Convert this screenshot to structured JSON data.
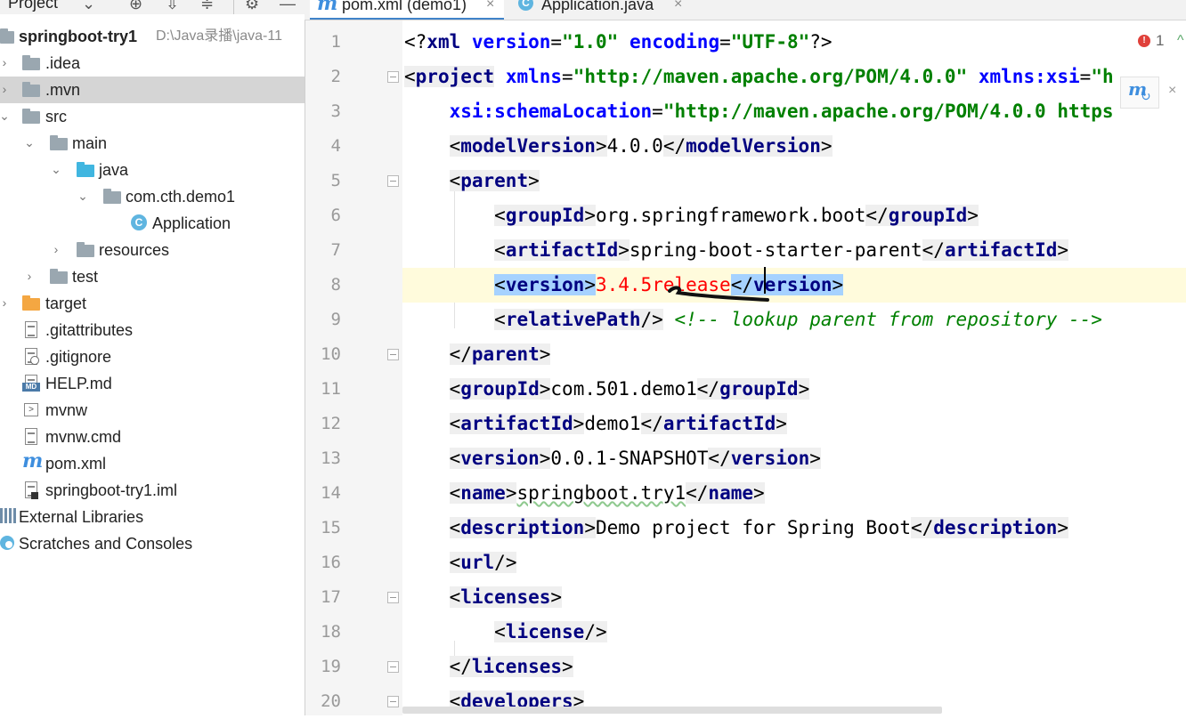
{
  "project_panel": {
    "title": "Project",
    "header_icons": [
      "chevron-down-icon",
      "locate-icon",
      "expand-all-icon",
      "collapse-all-icon",
      "gear-icon",
      "minimize-icon"
    ],
    "tree": [
      {
        "label": "springboot-try1",
        "path": "D:\\Java录播\\java-11",
        "icon": "module-folder-icon",
        "bold": true
      },
      {
        "label": ".idea",
        "icon": "folder-icon"
      },
      {
        "label": ".mvn",
        "icon": "folder-icon",
        "selected": true
      },
      {
        "label": "src",
        "icon": "folder-icon"
      },
      {
        "label": "main",
        "icon": "folder-icon"
      },
      {
        "label": "java",
        "icon": "source-folder-icon"
      },
      {
        "label": "com.cth.demo1",
        "icon": "package-icon"
      },
      {
        "label": "Application",
        "icon": "class-icon"
      },
      {
        "label": "resources",
        "icon": "resources-folder-icon"
      },
      {
        "label": "test",
        "icon": "folder-icon"
      },
      {
        "label": "target",
        "icon": "excluded-folder-icon"
      },
      {
        "label": ".gitattributes",
        "icon": "text-file-icon"
      },
      {
        "label": ".gitignore",
        "icon": "gitignore-file-icon"
      },
      {
        "label": "HELP.md",
        "icon": "markdown-file-icon",
        "badge": "MD"
      },
      {
        "label": "mvnw",
        "icon": "script-file-icon"
      },
      {
        "label": "mvnw.cmd",
        "icon": "text-file-icon"
      },
      {
        "label": "pom.xml",
        "icon": "maven-icon"
      },
      {
        "label": "springboot-try1.iml",
        "icon": "iml-file-icon"
      },
      {
        "label": "External Libraries",
        "icon": "libraries-icon"
      },
      {
        "label": "Scratches and Consoles",
        "icon": "scratches-icon"
      }
    ]
  },
  "tabs": [
    {
      "label": "pom.xml (demo1)",
      "icon": "maven-icon",
      "active": true
    },
    {
      "label": "Application.java",
      "icon": "class-icon",
      "active": false
    }
  ],
  "editor": {
    "error_count": "1",
    "line_numbers": [
      "1",
      "2",
      "3",
      "4",
      "5",
      "6",
      "7",
      "8",
      "9",
      "10",
      "11",
      "12",
      "13",
      "14",
      "15",
      "16",
      "17",
      "18",
      "19",
      "20"
    ],
    "code": {
      "l1_decl_open": "<?",
      "l1_xml": "xml",
      "l1_version_attr": "version",
      "l1_version_val": "\"1.0\"",
      "l1_encoding_attr": "encoding",
      "l1_encoding_val": "\"UTF-8\"",
      "l1_decl_close": "?>",
      "l2_tag": "project",
      "l2_attr": "xmlns",
      "l2_val": "\"http://maven.apache.org/POM/4.0.0\"",
      "l2_attr2": "xmlns:xsi",
      "l2_val2": "\"h",
      "l3_attr": "xsi:schemaLocation",
      "l3_val": "\"http://maven.apache.org/POM/4.0.0 https",
      "l4_tag": "modelVersion",
      "l4_text": "4.0.0",
      "l5_tag": "parent",
      "l6_tag": "groupId",
      "l6_text": "org.springframework.boot",
      "l7_tag": "artifactId",
      "l7_text": "spring-boot-starter-parent",
      "l8_tag": "version",
      "l8_text": "3.4.5release",
      "l9_tag": "relativePath",
      "l9_comment": "<!-- lookup parent from repository -->",
      "l10_tag": "parent",
      "l11_tag": "groupId",
      "l11_text": "com.501.demo1",
      "l12_tag": "artifactId",
      "l12_text": "demo1",
      "l13_tag": "version",
      "l13_text": "0.0.1-SNAPSHOT",
      "l14_tag": "name",
      "l14_text": "springboot.try1",
      "l15_tag": "description",
      "l15_text": "Demo project for Spring Boot",
      "l16_tag": "url",
      "l17_tag": "licenses",
      "l18_tag": "license",
      "l19_tag": "licenses",
      "l20_tag": "developers"
    }
  },
  "colors": {
    "tag": "#000080",
    "attribute": "#0000ff",
    "string": "#008000",
    "error": "#ff0000",
    "selection": "#a6d2ff",
    "caret_row": "#fffbdc"
  }
}
